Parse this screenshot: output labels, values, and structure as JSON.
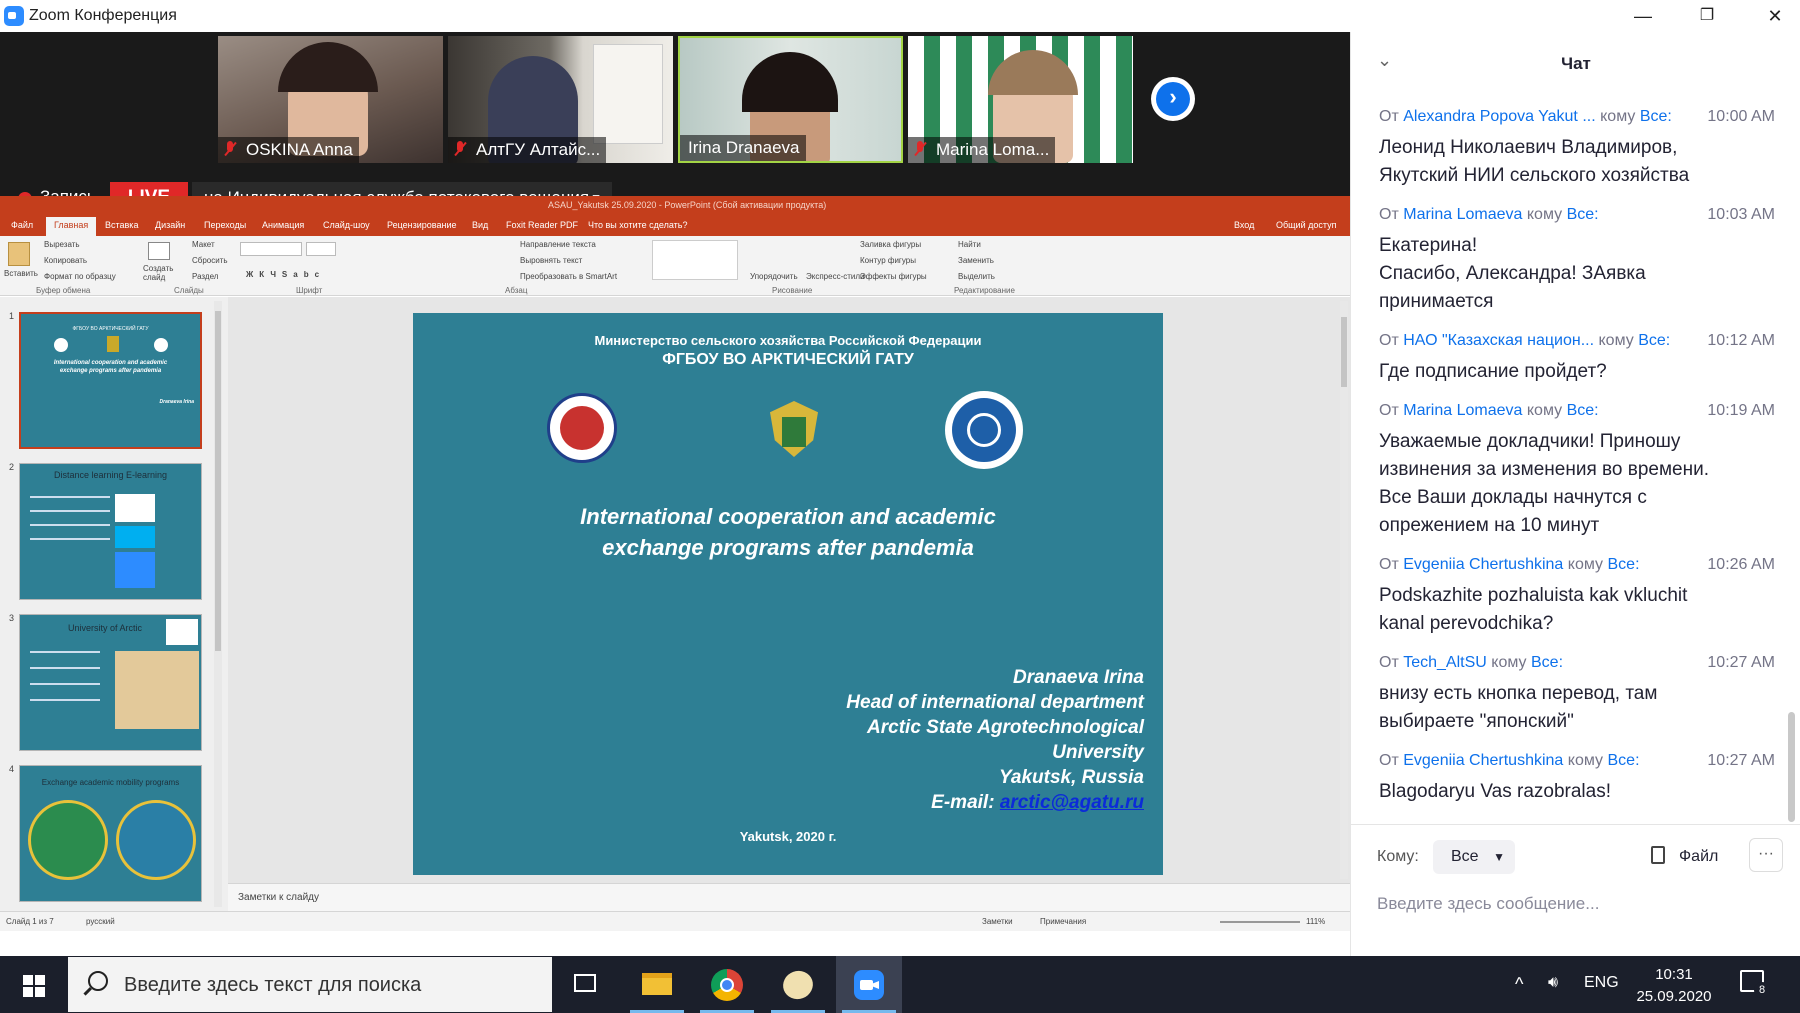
{
  "window": {
    "title": "Zoom Конференция",
    "minimize": "—",
    "restore": "❐",
    "close": "✕"
  },
  "participants": [
    {
      "name": "OSKINA Anna",
      "muted": true
    },
    {
      "name": "АлтГУ Алтайс...",
      "muted": true
    },
    {
      "name": "Irina Dranaeva",
      "muted": false,
      "active_speaker": true
    },
    {
      "name": "Marina Loma...",
      "muted": true
    }
  ],
  "next_page_icon": "›",
  "recording": {
    "label": "Запись",
    "live_badge": "LIVE",
    "stream_label": "на Индивидуальная служба потокового вещания"
  },
  "powerpoint": {
    "window_title": "ASAU_Yakutsk 25.09.2020 - PowerPoint (Сбой активации продукта)",
    "tabs": [
      "Файл",
      "Главная",
      "Вставка",
      "Дизайн",
      "Переходы",
      "Анимация",
      "Слайд-шоу",
      "Рецензирование",
      "Вид",
      "Foxit Reader PDF",
      "Что вы хотите сделать?"
    ],
    "tab_right": [
      "Вход",
      "Общий доступ"
    ],
    "ribbon": {
      "paste": "Вставить",
      "cut": "Вырезать",
      "copy": "Копировать",
      "format_painter": "Формат по образцу",
      "new_slide": "Создать слайд",
      "layout": "Макет",
      "reset": "Сбросить",
      "section": "Раздел",
      "text_direction": "Направление текста",
      "align_text": "Выровнять текст",
      "smartart": "Преобразовать в SmartArt",
      "arrange": "Упорядочить",
      "quick_styles": "Экспресс-стили",
      "shape_fill": "Заливка фигуры",
      "shape_outline": "Контур фигуры",
      "shape_effects": "Эффекты фигуры",
      "find": "Найти",
      "replace": "Заменить",
      "select": "Выделить",
      "groups": [
        "Буфер обмена",
        "Слайды",
        "Шрифт",
        "Абзац",
        "Рисование",
        "Редактирование"
      ]
    },
    "thumbnails": [
      {
        "num": "1",
        "title": "International cooperation and academic exchange programs after pandemia",
        "selected": true
      },
      {
        "num": "2",
        "title": "Distance learning E-learning"
      },
      {
        "num": "3",
        "title": "University of Arctic"
      },
      {
        "num": "4",
        "title": "Exchange academic mobility programs"
      }
    ],
    "slide": {
      "ministry": "Министерство сельского хозяйства Российской Федерации",
      "university": "ФГБОУ ВО АРКТИЧЕСКИЙ ГАТУ",
      "headline_1": "International cooperation and academic",
      "headline_2": "exchange programs after pandemia",
      "author_name": "Dranaeva Irina",
      "author_position": "Head of international department",
      "author_uni_1": "Arctic State Agrotechnological",
      "author_uni_2": "University",
      "author_city": "Yakutsk, Russia",
      "email_label": "E-mail:",
      "email": "arctic@agatu.ru",
      "footer": "Yakutsk, 2020 г."
    },
    "notes_placeholder": "Заметки к слайду",
    "status": {
      "slide_counter": "Слайд 1 из 7",
      "language": "русский",
      "notes": "Заметки",
      "comments": "Примечания",
      "zoom": "111%"
    }
  },
  "chat": {
    "title": "Чат",
    "collapse_icon": "⌄",
    "from_label": "От",
    "to_label": "кому",
    "messages": [
      {
        "from": "Alexandra Popova Yakut ...",
        "to": "Все:",
        "time": "10:00 AM",
        "lines": [
          "Леонид Николаевич Владимиров,",
          "Якутский НИИ сельского хозяйства"
        ]
      },
      {
        "from": "Marina Lomaeva",
        "to": "Все:",
        "time": "10:03 AM",
        "lines": [
          "Екатерина!",
          "Спасибо, Александра! ЗАявка",
          "принимается"
        ]
      },
      {
        "from": "НАО \"Казахская национ...",
        "to": "Все:",
        "time": "10:12 AM",
        "lines": [
          "Где подписание пройдет?"
        ]
      },
      {
        "from": "Marina Lomaeva",
        "to": "Все:",
        "time": "10:19 AM",
        "lines": [
          "Уважаемые докладчики! Приношу",
          "извинения за изменения во времени.",
          "Все Ваши доклады начнутся с",
          "опрежением на 10 минут"
        ]
      },
      {
        "from": "Evgeniia Chertushkina",
        "to": "Все:",
        "time": "10:26 AM",
        "lines": [
          "Podskazhite pozhaluista kak vkluchit",
          "kanal perevodchika?"
        ]
      },
      {
        "from": "Tech_AltSU",
        "to": "Все:",
        "time": "10:27 AM",
        "lines": [
          "внизу есть кнопка перевод, там",
          "выбираете \"японский\""
        ]
      },
      {
        "from": "Evgeniia Chertushkina",
        "to": "Все:",
        "time": "10:27 AM",
        "lines": [
          "Blagodaryu Vas razobralas!"
        ]
      }
    ],
    "to_field_label": "Кому:",
    "recipient": "Все",
    "file_button": "Файл",
    "more_button": "···",
    "input_placeholder": "Введите здесь сообщение..."
  },
  "taskbar": {
    "search_placeholder": "Введите здесь текст для поиска",
    "language": "ENG",
    "time": "10:31",
    "date": "25.09.2020",
    "notifications_count": "8"
  }
}
